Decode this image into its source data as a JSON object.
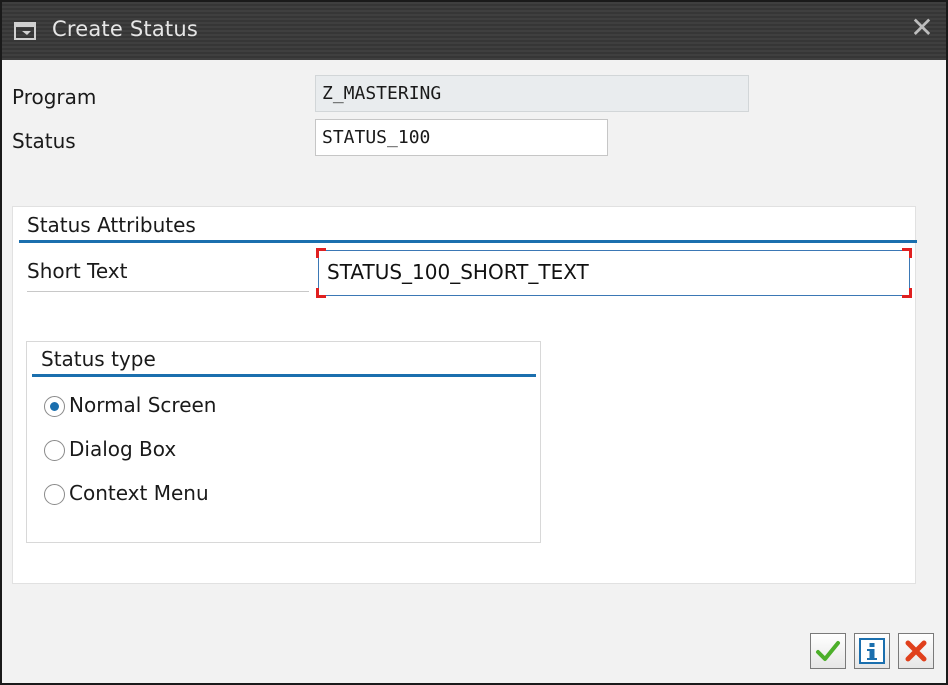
{
  "window": {
    "title": "Create Status",
    "close_glyph": "✕",
    "title_icon": "dialog-icon"
  },
  "form": {
    "program_label": "Program",
    "program_value": "Z_MASTERING",
    "status_label": "Status",
    "status_value": "STATUS_100"
  },
  "attributes": {
    "section_title": "Status Attributes",
    "short_text_label": "Short Text",
    "short_text_value": "STATUS_100_SHORT_TEXT"
  },
  "status_type": {
    "title": "Status type",
    "options": [
      {
        "label": "Normal Screen",
        "checked": true
      },
      {
        "label": "Dialog Box",
        "checked": false
      },
      {
        "label": "Context Menu",
        "checked": false
      }
    ]
  },
  "buttons": {
    "confirm_icon": "checkmark-icon",
    "info_icon": "info-icon",
    "cancel_icon": "cancel-icon"
  },
  "colors": {
    "accent": "#1b6fae",
    "titlebar": "#3a3a3a",
    "required_marker": "#e02020",
    "confirm": "#4caf2a",
    "cancel": "#e0401c"
  }
}
